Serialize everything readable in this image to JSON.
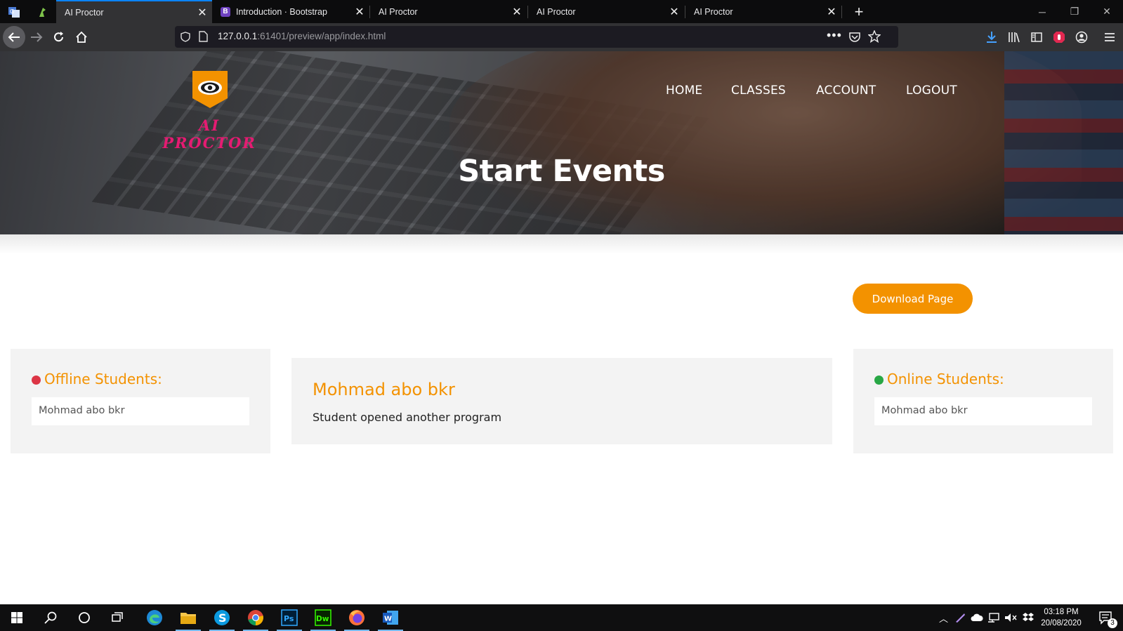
{
  "browser": {
    "tabs": [
      {
        "label": "AI Proctor",
        "active": true
      },
      {
        "label": "Introduction · Bootstrap",
        "active": false
      },
      {
        "label": "AI Proctor",
        "active": false
      },
      {
        "label": "AI Proctor",
        "active": false
      },
      {
        "label": "AI Proctor",
        "active": false
      }
    ],
    "url_host": "127.0.0.1",
    "url_path": ":61401/preview/app/index.html"
  },
  "site": {
    "brand": "AI PROCTOR",
    "nav": [
      "HOME",
      "CLASSES",
      "ACCOUNT",
      "LOGOUT"
    ],
    "page_title": "Start Events",
    "download_label": "Download Page"
  },
  "offline": {
    "title": "Offline Students:",
    "students": [
      "Mohmad abo bkr"
    ]
  },
  "event": {
    "student": "Mohmad abo bkr",
    "message": "Student opened another program"
  },
  "online": {
    "title": "Online Students:",
    "students": [
      "Mohmad abo bkr"
    ]
  },
  "taskbar": {
    "time": "03:18 PM",
    "date": "20/08/2020",
    "notifications": "3"
  },
  "colors": {
    "accent": "#f39200",
    "offline_dot": "#dc3545",
    "online_dot": "#28a745",
    "brand_text": "#e51b72",
    "tab_highlight": "#0a84ff"
  }
}
